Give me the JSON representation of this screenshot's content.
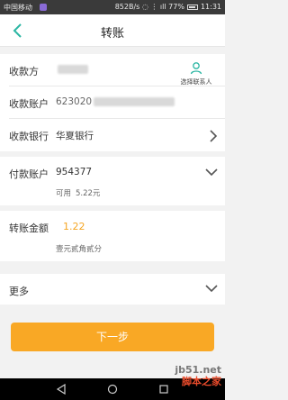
{
  "status_bar": {
    "carrier": "中国移动",
    "right_text": "852B/s  ◌ ⋮ ıll 77%",
    "time": "11:31"
  },
  "header": {
    "title": "转账"
  },
  "payee": {
    "name_label": "收款方",
    "contact_label": "选择联系人",
    "account_label": "收款账户",
    "account_value": "623020",
    "bank_label": "收款银行",
    "bank_value": "华夏银行"
  },
  "payer": {
    "account_label": "付款账户",
    "account_value": "954377",
    "available_label": "可用",
    "available_value": "5.22元"
  },
  "transfer": {
    "amount_label": "转账金额",
    "amount_value": "1.22",
    "amount_in_words": "壹元贰角贰分"
  },
  "more": {
    "label": "更多"
  },
  "next_button": {
    "label": "下一步"
  },
  "watermark": {
    "line1": "jb51.net",
    "line2": "脚本之家"
  },
  "colors": {
    "accent": "#f9a825",
    "amount": "#f5a623",
    "teal": "#2bb6a3"
  }
}
